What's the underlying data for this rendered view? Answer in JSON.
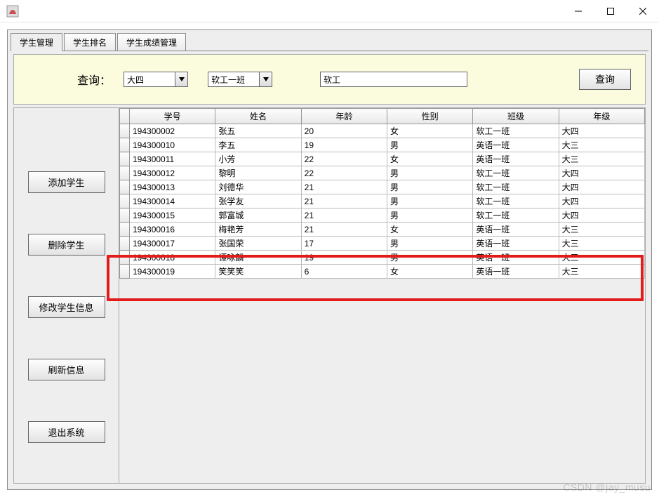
{
  "window": {
    "title": ""
  },
  "tabs": [
    {
      "label": "学生管理",
      "active": true
    },
    {
      "label": "学生排名",
      "active": false
    },
    {
      "label": "学生成绩管理",
      "active": false
    }
  ],
  "query": {
    "label": "查询：",
    "grade_value": "大四",
    "class_value": "软工一班",
    "keyword_value": "软工",
    "submit": "查询"
  },
  "sidebar": {
    "add": "添加学生",
    "delete": "删除学生",
    "edit": "修改学生信息",
    "refresh": "刷新信息",
    "exit": "退出系统"
  },
  "table": {
    "headers": [
      "学号",
      "姓名",
      "年龄",
      "性别",
      "班级",
      "年级"
    ],
    "rows": [
      [
        "194300002",
        "张五",
        "20",
        "女",
        "软工一班",
        "大四"
      ],
      [
        "194300010",
        "李五",
        "19",
        "男",
        "英语一班",
        "大三"
      ],
      [
        "194300011",
        "小芳",
        "22",
        "女",
        "英语一班",
        "大三"
      ],
      [
        "194300012",
        "黎明",
        "22",
        "男",
        "软工一班",
        "大四"
      ],
      [
        "194300013",
        "刘德华",
        "21",
        "男",
        "软工一班",
        "大四"
      ],
      [
        "194300014",
        "张学友",
        "21",
        "男",
        "软工一班",
        "大四"
      ],
      [
        "194300015",
        "郭富城",
        "21",
        "男",
        "软工一班",
        "大四"
      ],
      [
        "194300016",
        "梅艳芳",
        "21",
        "女",
        "英语一班",
        "大三"
      ],
      [
        "194300017",
        "张国荣",
        "17",
        "男",
        "英语一班",
        "大三"
      ],
      [
        "194300018",
        "谭咏麟",
        "19",
        "男",
        "英语一班",
        "大三"
      ],
      [
        "194300019",
        "笑笑笑",
        "6",
        "女",
        "英语一班",
        "大三"
      ]
    ]
  },
  "highlight_row_range": {
    "start": 10,
    "end": 10
  },
  "watermark": "CSDN @jay_musu"
}
